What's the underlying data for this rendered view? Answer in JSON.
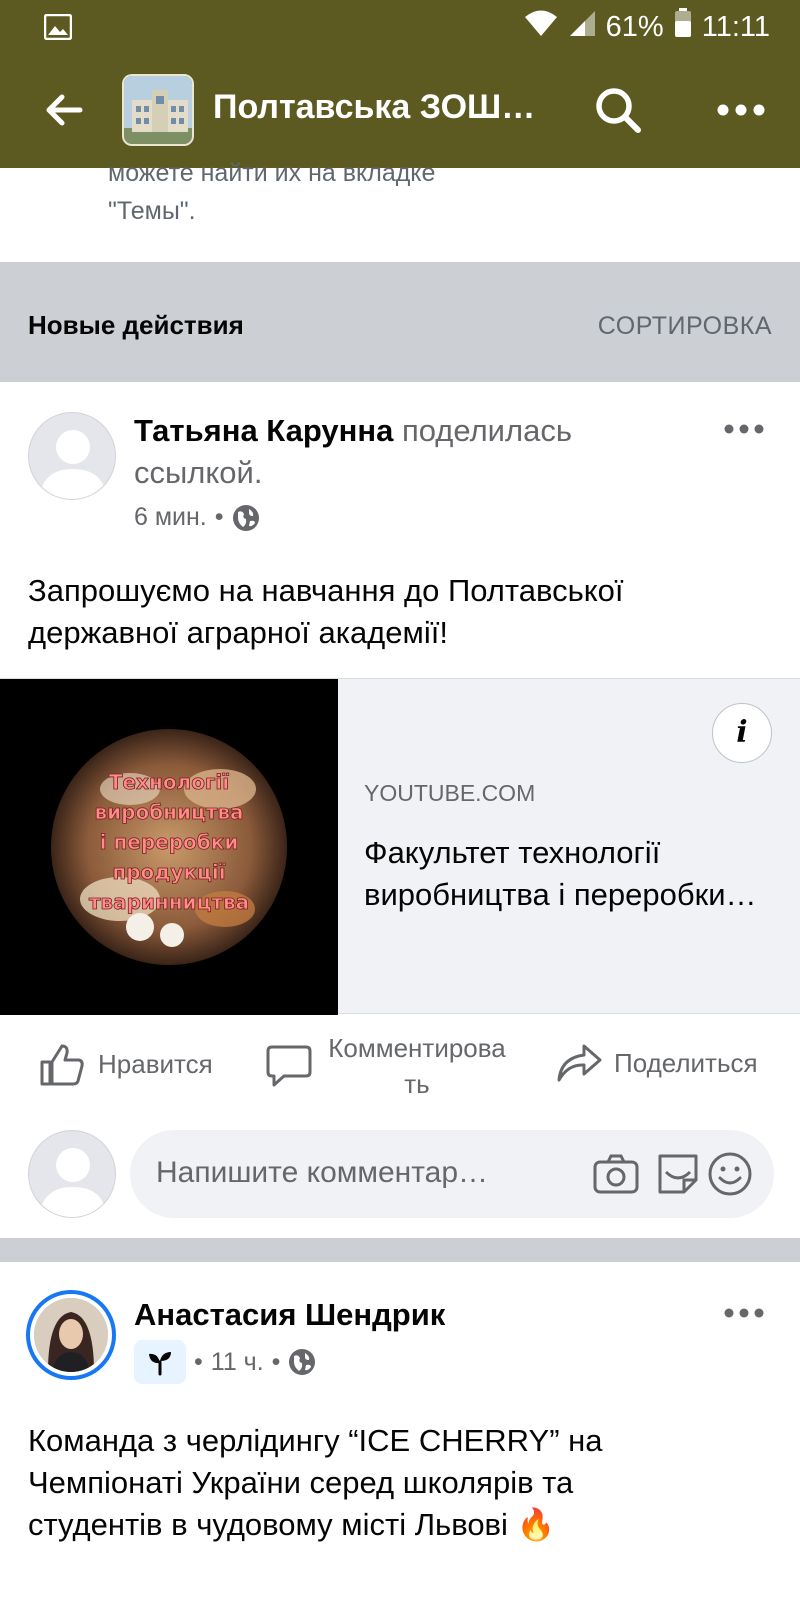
{
  "status_bar": {
    "battery": "61%",
    "time": "11:11",
    "icons": [
      "gallery-icon",
      "wifi-icon",
      "signal-icon",
      "battery-icon"
    ]
  },
  "app_bar": {
    "title": "Полтавська ЗОШ…",
    "icons": [
      "back-arrow-icon",
      "search-icon",
      "more-horizontal-icon"
    ]
  },
  "pinned_note": {
    "line1": "можете найти их на вкладке",
    "line2": "\"Темы\"."
  },
  "section": {
    "title": "Новые действия",
    "sort_label": "СОРТИРОВКА"
  },
  "post1": {
    "author": "Татьяна Карунна",
    "action": "поделилась ссылкой.",
    "time": "6 мин.",
    "separator": "•",
    "text_line1": "Запрошуємо на навчання до Полтавської",
    "text_line2": "державної аграрної академії!",
    "link": {
      "thumbnail_caption": [
        "Технології",
        "виробництва",
        "і переробки",
        "продукції",
        "тваринництва"
      ],
      "info_label": "i",
      "domain": "YOUTUBE.COM",
      "title_line1": "Факультет технології",
      "title_line2": "виробництва і переробки…"
    },
    "actions": {
      "like": "Нравится",
      "comment_line1": "Комментирова",
      "comment_line2": "ть",
      "share": "Поделиться"
    },
    "comment_placeholder": "Напишите комментар…"
  },
  "post2": {
    "author": "Анастасия Шендрик",
    "time": "11 ч.",
    "separator": "•",
    "text_line1": "Команда з черлідингу “ICE CHERRY” на",
    "text_line2": "Чемпіонаті України серед школярів та",
    "text_line3": "студентів в чудовому місті Львові 🔥"
  },
  "colors": {
    "app_bar": "#5c5a21",
    "section_bg": "#ccd0d5",
    "accent": "#1877f2",
    "secondary_text": "#65676b"
  }
}
